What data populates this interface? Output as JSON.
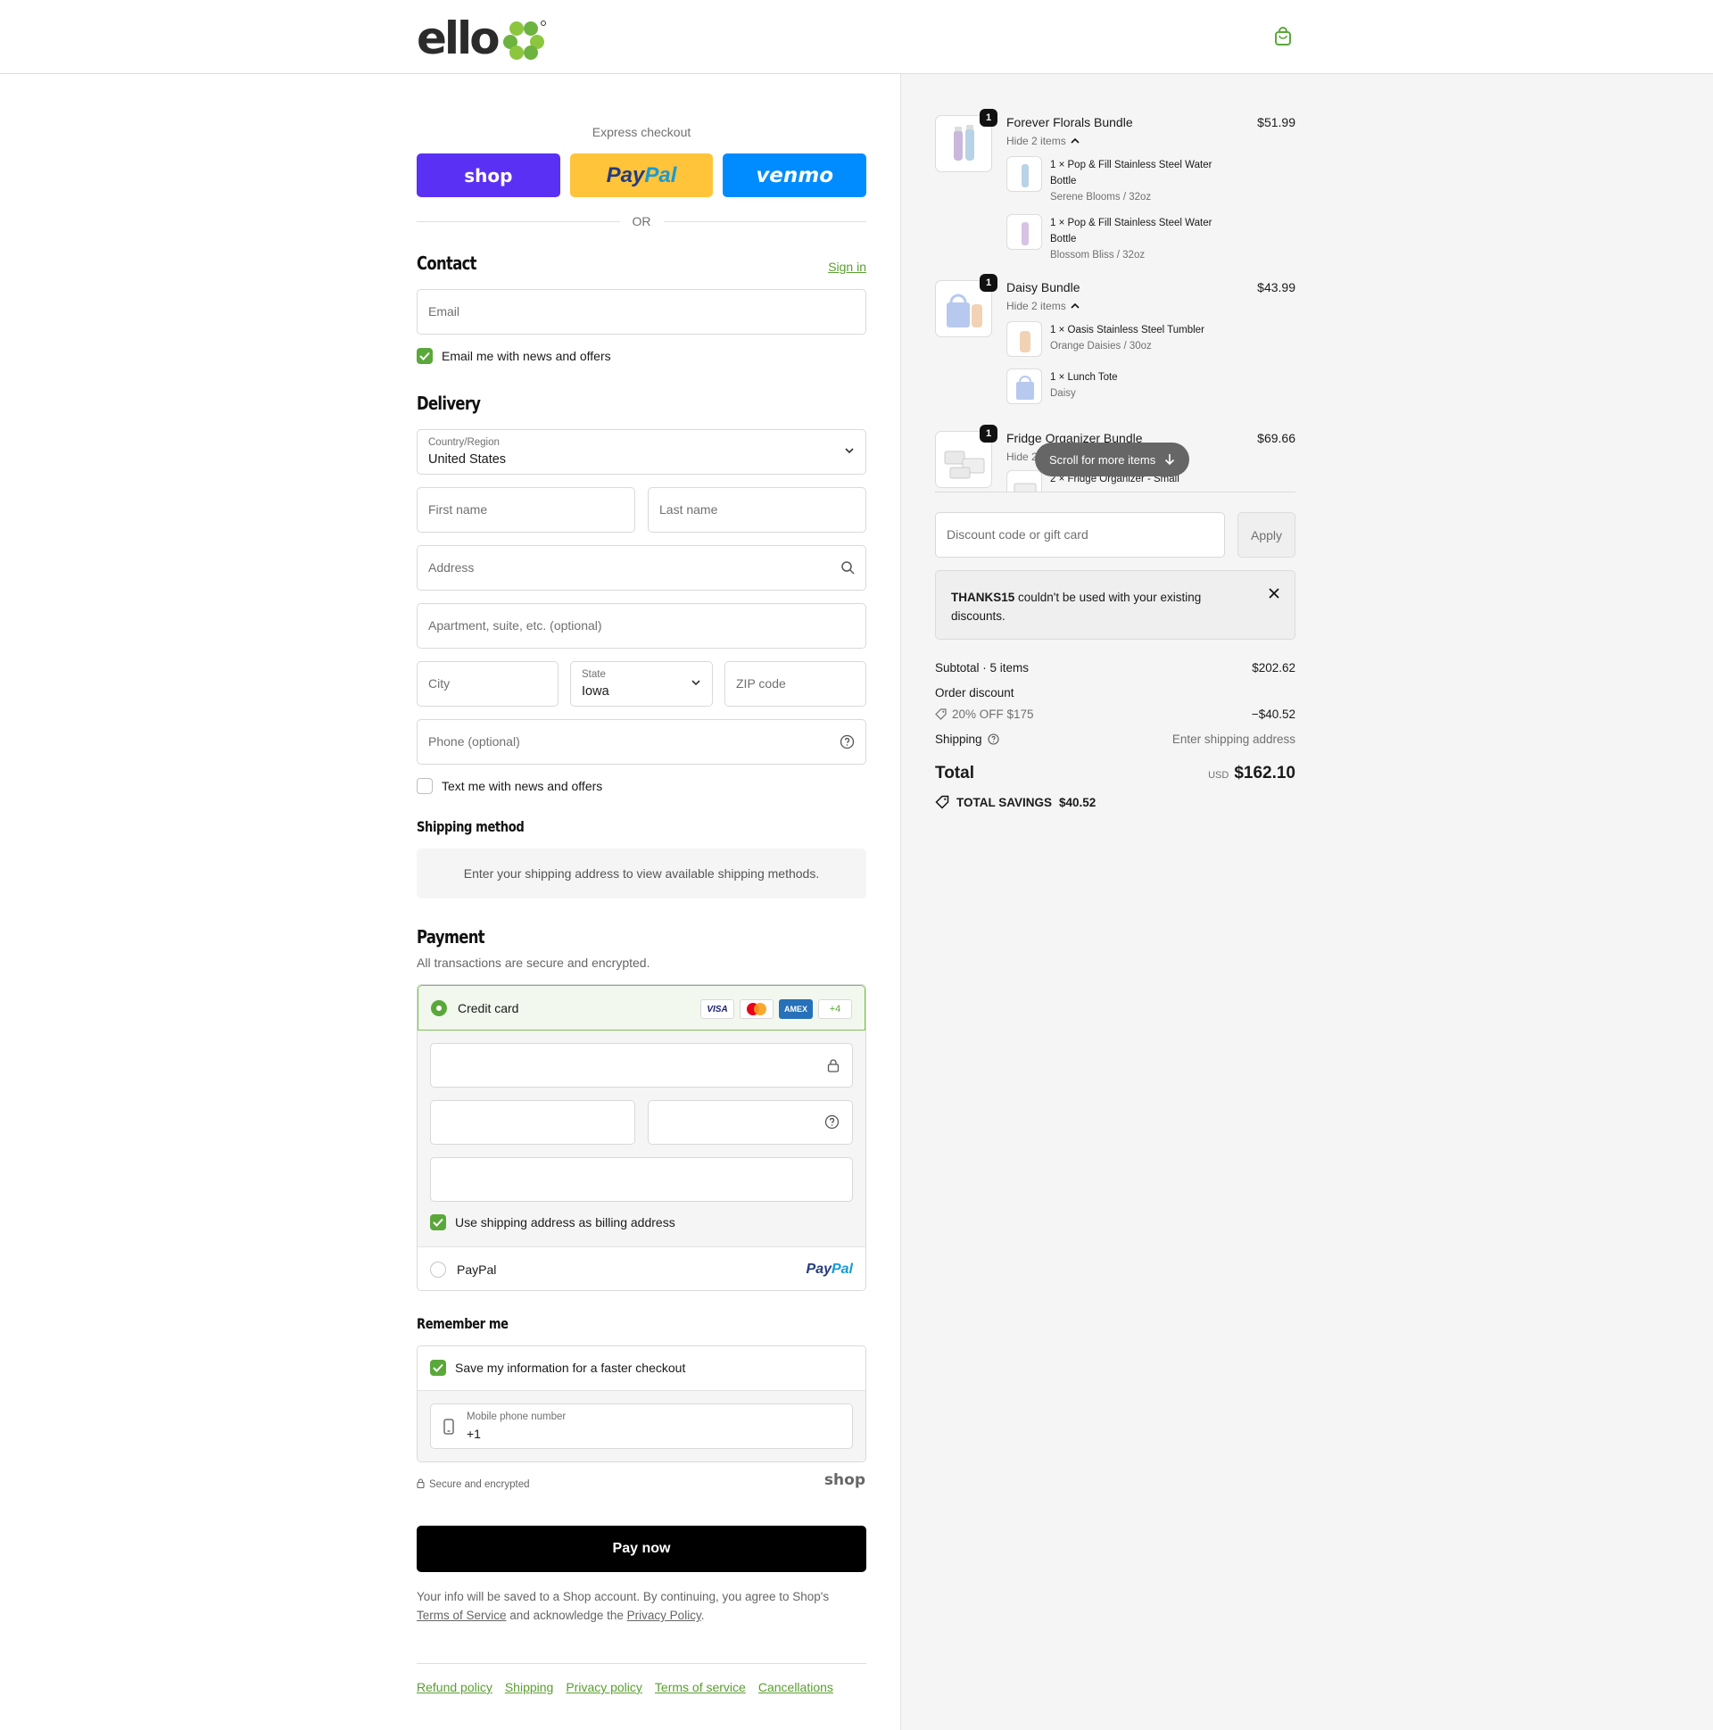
{
  "brand": {
    "name": "ello"
  },
  "express": {
    "label": "Express checkout",
    "shop_label": "shop",
    "paypal_a": "Pay",
    "paypal_b": "Pal",
    "venmo_label": "venmo",
    "or_label": "OR"
  },
  "contact": {
    "title": "Contact",
    "sign_in": "Sign in",
    "email_placeholder": "Email",
    "email_offers": "Email me with news and offers"
  },
  "delivery": {
    "title": "Delivery",
    "country_label": "Country/Region",
    "country_value": "United States",
    "first_name": "First name",
    "last_name": "Last name",
    "address": "Address",
    "apartment": "Apartment, suite, etc. (optional)",
    "city": "City",
    "state_label": "State",
    "state_value": "Iowa",
    "zip": "ZIP code",
    "phone": "Phone (optional)",
    "text_offers": "Text me with news and offers"
  },
  "shipping_method": {
    "title": "Shipping method",
    "note": "Enter your shipping address to view available shipping methods."
  },
  "payment": {
    "title": "Payment",
    "subtitle": "All transactions are secure and encrypted.",
    "credit_card": "Credit card",
    "cards": [
      "VISA",
      "",
      "AMEX",
      "+4"
    ],
    "billing_same": "Use shipping address as billing address",
    "paypal": "PayPal",
    "paypal_logo_a": "Pay",
    "paypal_logo_b": "Pal"
  },
  "remember": {
    "title": "Remember me",
    "save_info": "Save my information for a faster checkout",
    "mobile_label": "Mobile phone number",
    "mobile_value": "+1",
    "secure": "Secure and encrypted",
    "shop": "shop"
  },
  "pay_now": "Pay now",
  "legal": {
    "text1": "Your info will be saved to a Shop account. By continuing, you agree to Shop's",
    "tos": "Terms of Service",
    "text2": "and acknowledge the",
    "privacy": "Privacy Policy",
    "text3": "."
  },
  "footer": [
    "Refund policy",
    "Shipping",
    "Privacy policy",
    "Terms of service",
    "Cancellations"
  ],
  "summary": {
    "bundles": [
      {
        "name": "Forever Florals Bundle",
        "price": "$51.99",
        "qty": "1",
        "hide": "Hide 2 items",
        "items": [
          {
            "name": "1 × Pop & Fill Stainless Steel Water Bottle",
            "variant": "Serene Blooms / 32oz"
          },
          {
            "name": "1 × Pop & Fill Stainless Steel Water Bottle",
            "variant": "Blossom Bliss / 32oz"
          }
        ]
      },
      {
        "name": "Daisy Bundle",
        "price": "$43.99",
        "qty": "1",
        "hide": "Hide 2 items",
        "items": [
          {
            "name": "1 × Oasis Stainless Steel Tumbler",
            "variant": "Orange Daisies / 30oz"
          },
          {
            "name": "1 × Lunch Tote",
            "variant": "Daisy"
          }
        ]
      },
      {
        "name": "Fridge Organizer Bundle",
        "price": "$69.66",
        "qty": "1",
        "hide": "Hide 2",
        "items": [
          {
            "name": "2 × Fridge Organizer - Small",
            "variant": ""
          }
        ]
      }
    ],
    "scroll_more": "Scroll for more items",
    "discount_placeholder": "Discount code or gift card",
    "apply": "Apply",
    "notice_code": "THANKS15",
    "notice_text": " couldn't be used with your existing discounts.",
    "subtotal_label": "Subtotal · 5 items",
    "subtotal_value": "$202.62",
    "order_discount": "Order discount",
    "discount_name": "20% OFF $175",
    "discount_value": "−$40.52",
    "shipping_label": "Shipping",
    "shipping_value": "Enter shipping address",
    "total_label": "Total",
    "total_currency": "USD",
    "total_value": "$162.10",
    "savings_label": "TOTAL SAVINGS",
    "savings_value": "$40.52"
  },
  "colors": {
    "accent": "#5aa83a",
    "shop": "#5a31f4",
    "paypal": "#ffc439",
    "venmo": "#008cff"
  }
}
